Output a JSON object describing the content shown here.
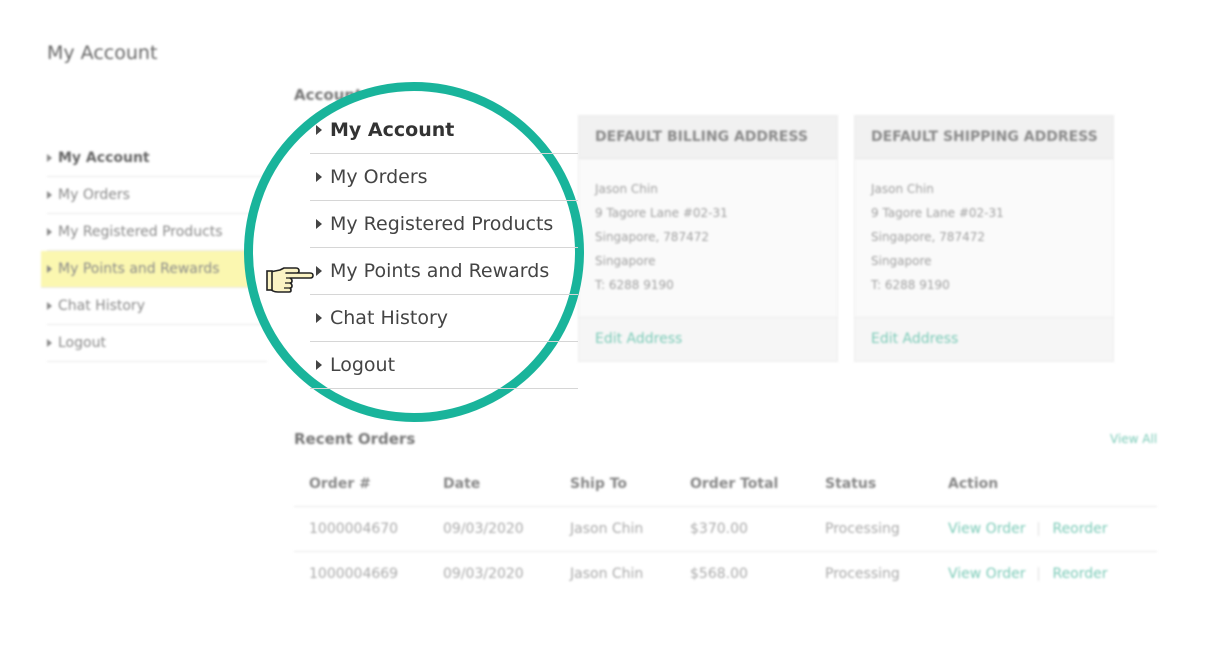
{
  "page_title": "My Account",
  "account_section_title": "Account",
  "sidebar": {
    "items": [
      {
        "label": "My Account"
      },
      {
        "label": "My Orders"
      },
      {
        "label": "My Registered Products"
      },
      {
        "label": "My Points and Rewards"
      },
      {
        "label": "Chat History"
      },
      {
        "label": "Logout"
      }
    ]
  },
  "billing": {
    "title": "DEFAULT BILLING ADDRESS",
    "lines": [
      "Jason Chin",
      "9 Tagore Lane #02-31",
      "Singapore, 787472",
      "Singapore",
      "T: 6288 9190"
    ],
    "edit_label": "Edit Address"
  },
  "shipping": {
    "title": "DEFAULT SHIPPING ADDRESS",
    "lines": [
      "Jason Chin",
      "9 Tagore Lane #02-31",
      "Singapore, 787472",
      "Singapore",
      "T: 6288 9190"
    ],
    "edit_label": "Edit Address"
  },
  "recent_orders": {
    "title": "Recent Orders",
    "view_all": "View All",
    "columns": [
      "Order #",
      "Date",
      "Ship To",
      "Order Total",
      "Status",
      "Action"
    ],
    "rows": [
      {
        "order": "1000004670",
        "date": "09/03/2020",
        "ship_to": "Jason Chin",
        "total": "$370.00",
        "status": "Processing",
        "view": "View Order",
        "reorder": "Reorder"
      },
      {
        "order": "1000004669",
        "date": "09/03/2020",
        "ship_to": "Jason Chin",
        "total": "$568.00",
        "status": "Processing",
        "view": "View Order",
        "reorder": "Reorder"
      }
    ]
  },
  "magnifier": {
    "items": [
      {
        "label": "My Account"
      },
      {
        "label": "My Orders"
      },
      {
        "label": "My Registered Products"
      },
      {
        "label": "My Points and Rewards"
      },
      {
        "label": "Chat History"
      },
      {
        "label": "Logout"
      }
    ],
    "ring_color": "#19b49b",
    "pointer_icon": "pointing-hand-icon"
  },
  "colors": {
    "accent": "#19b49b",
    "link": "#7ccbb8",
    "highlight": "#fbf7b0"
  }
}
